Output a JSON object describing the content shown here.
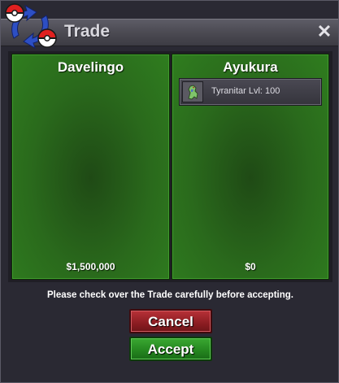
{
  "window": {
    "title": "Trade",
    "close_glyph": "✕"
  },
  "left_panel": {
    "player_name": "Davelingo",
    "money": "$1,500,000",
    "items": []
  },
  "right_panel": {
    "player_name": "Ayukura",
    "money": "$0",
    "items": [
      {
        "label": "Tyranitar  Lvl: 100",
        "icon": "tyranitar-sprite-icon"
      }
    ]
  },
  "notice": "Please check over the Trade carefully before accepting.",
  "buttons": {
    "cancel_label": "Cancel",
    "accept_label": "Accept"
  },
  "colors": {
    "panel_green": "#2f7d1f",
    "cancel_red": "#8c1d22",
    "accept_green": "#24851f"
  }
}
